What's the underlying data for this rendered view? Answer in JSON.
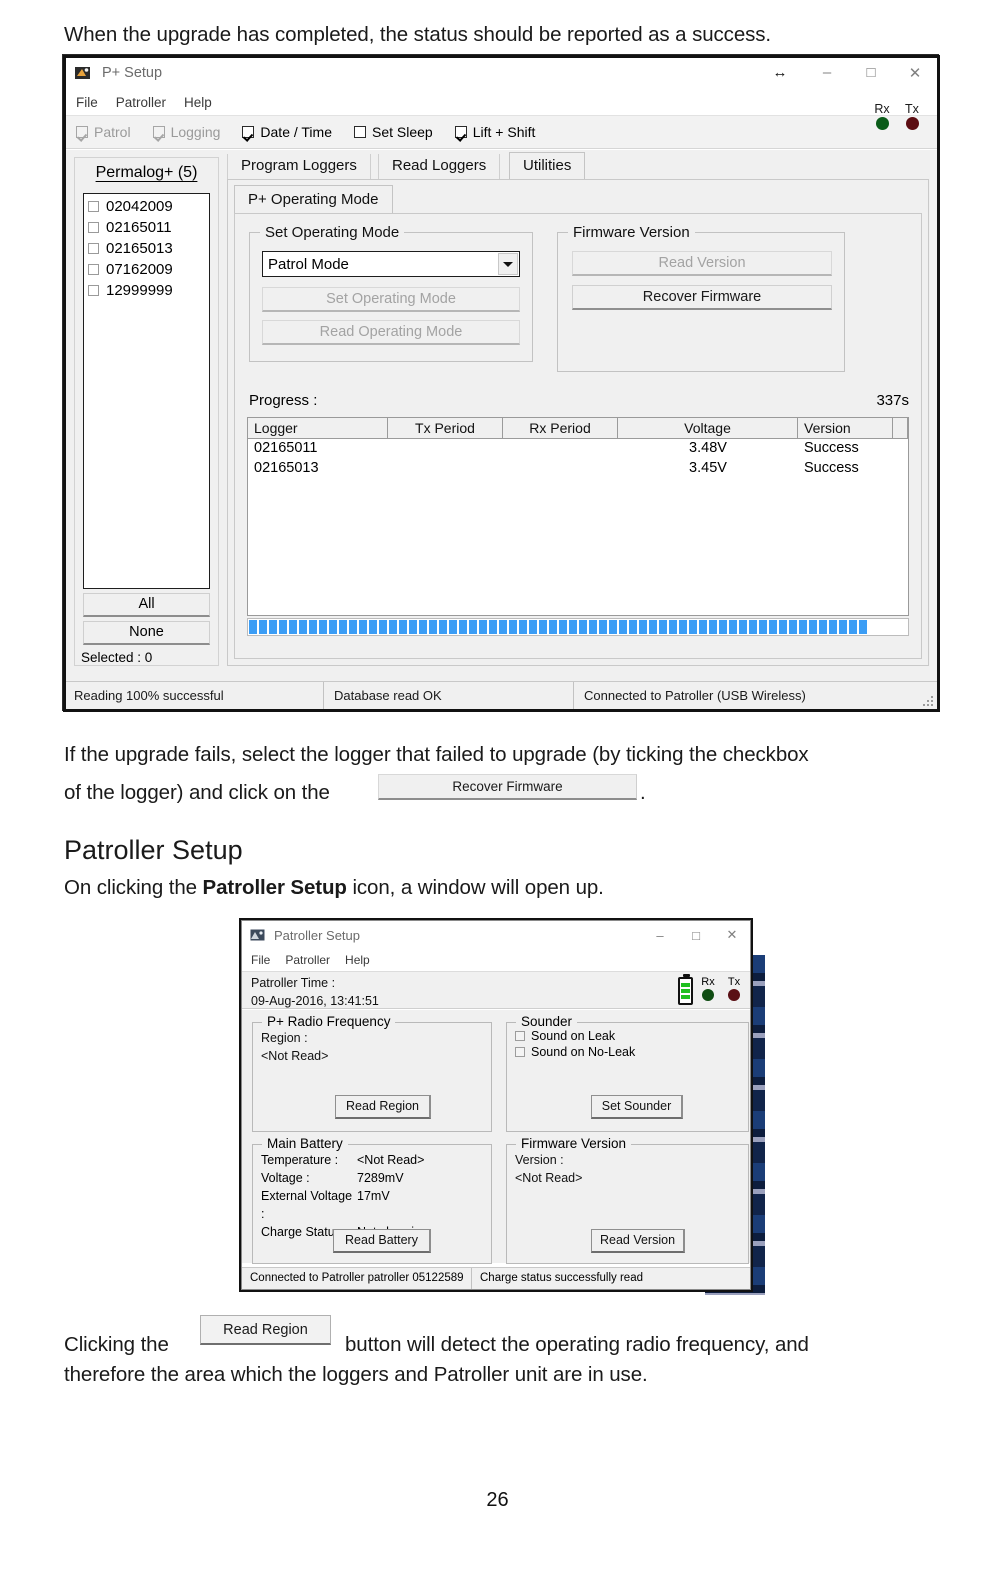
{
  "document": {
    "intro_text": "When the upgrade has completed, the status should be reported as a success.",
    "fail_text_1": "If the upgrade fails, select the logger that failed to upgrade (by ticking the checkbox",
    "fail_text_2": "of the logger) and click on the",
    "fail_text_3": ".",
    "inline_recover_button": "Recover Firmware",
    "section_heading": "Patroller Setup",
    "section_intro_a": "On clicking the ",
    "section_intro_b": "Patroller Setup",
    "section_intro_c": " icon, a window will open up.",
    "clicking_a": "Clicking  the",
    "inline_read_region_button": "Read Region",
    "clicking_b": "button  will  detect  the  operating  radio  frequency,  and",
    "clicking_c": "therefore the area which the loggers and Patroller unit are in use.",
    "page_number": "26"
  },
  "psetup": {
    "title": "P+ Setup",
    "menu": [
      "File",
      "Patroller",
      "Help"
    ],
    "window_controls": {
      "resize": "↔",
      "minimize": "–",
      "maximize": "□",
      "close": "✕"
    },
    "toolbar_checkboxes": [
      {
        "label": "Patrol",
        "checked": true,
        "disabled": true
      },
      {
        "label": "Logging",
        "checked": true,
        "disabled": true
      },
      {
        "label": "Date / Time",
        "checked": true,
        "disabled": false
      },
      {
        "label": "Set Sleep",
        "checked": false,
        "disabled": false
      },
      {
        "label": "Lift + Shift",
        "checked": true,
        "disabled": false
      }
    ],
    "indicators": {
      "rx_label": "Rx",
      "tx_label": "Tx",
      "rx_color": "#0a5c19",
      "tx_color": "#5c0d12"
    },
    "logger_panel": {
      "heading": "Permalog+ (5)",
      "items": [
        "02042009",
        "02165011",
        "02165013",
        "07162009",
        "12999999"
      ],
      "all_button": "All",
      "none_button": "None",
      "selected_label": "Selected : 0"
    },
    "tabs": [
      {
        "label": "Program Loggers",
        "active": false
      },
      {
        "label": "Read Loggers",
        "active": false
      },
      {
        "label": "Utilities",
        "active": true
      }
    ],
    "inner_tabs": [
      {
        "label": "P+ Operating Mode",
        "active": true
      }
    ],
    "set_operating_mode": {
      "group_title": "Set Operating Mode",
      "combo_value": "Patrol Mode",
      "set_button": "Set Operating Mode",
      "read_button": "Read Operating Mode"
    },
    "firmware_version": {
      "group_title": "Firmware Version",
      "read_button": "Read Version",
      "recover_button": "Recover Firmware"
    },
    "progress": {
      "label": "Progress :",
      "elapsed": "337s",
      "columns": [
        "Logger",
        "Tx Period",
        "Rx Period",
        "Voltage",
        "Version",
        ""
      ],
      "rows": [
        {
          "logger": "02165011",
          "tx_period": "",
          "rx_period": "",
          "voltage": "3.48V",
          "version": "Success",
          "extra": ""
        },
        {
          "logger": "02165013",
          "tx_period": "",
          "rx_period": "",
          "voltage": "3.45V",
          "version": "Success",
          "extra": ""
        }
      ],
      "bar_percent": 100,
      "bar_color": "#3b9df5"
    },
    "statusbar": [
      "Reading 100% successful",
      "Database read OK",
      "Connected to Patroller (USB Wireless)"
    ]
  },
  "patroller": {
    "title": "Patroller Setup",
    "menu": [
      "File",
      "Patroller",
      "Help"
    ],
    "window_controls": {
      "minimize": "–",
      "maximize": "□",
      "close": "✕"
    },
    "time": {
      "label": "Patroller Time :",
      "value": "09-Aug-2016, 13:41:51"
    },
    "indicators": {
      "rx_label": "Rx",
      "tx_label": "Tx",
      "rx_color": "#0f4c12",
      "tx_color": "#5a1015",
      "battery_color": "#1fbf1f"
    },
    "radio_frequency": {
      "group_title": "P+ Radio Frequency",
      "region_label": "Region :",
      "region_value": "<Not Read>",
      "button": "Read Region"
    },
    "sounder": {
      "group_title": "Sounder",
      "checkboxes": [
        {
          "label": "Sound on Leak",
          "checked": false
        },
        {
          "label": "Sound on No-Leak",
          "checked": false
        }
      ],
      "button": "Set Sounder"
    },
    "main_battery": {
      "group_title": "Main Battery",
      "rows": [
        {
          "key": "Temperature :",
          "value": "<Not Read>"
        },
        {
          "key": "Voltage :",
          "value": "7289mV"
        },
        {
          "key": "External Voltage :",
          "value": "17mV"
        },
        {
          "key": "Charge Status :",
          "value": "Not charging"
        }
      ],
      "button": "Read Battery"
    },
    "firmware_version": {
      "group_title": "Firmware Version",
      "version_label": "Version :",
      "version_value": "<Not Read>",
      "button": "Read Version"
    },
    "statusbar": [
      "Connected to Patroller patroller 05122589",
      "Charge status successfully read"
    ]
  }
}
